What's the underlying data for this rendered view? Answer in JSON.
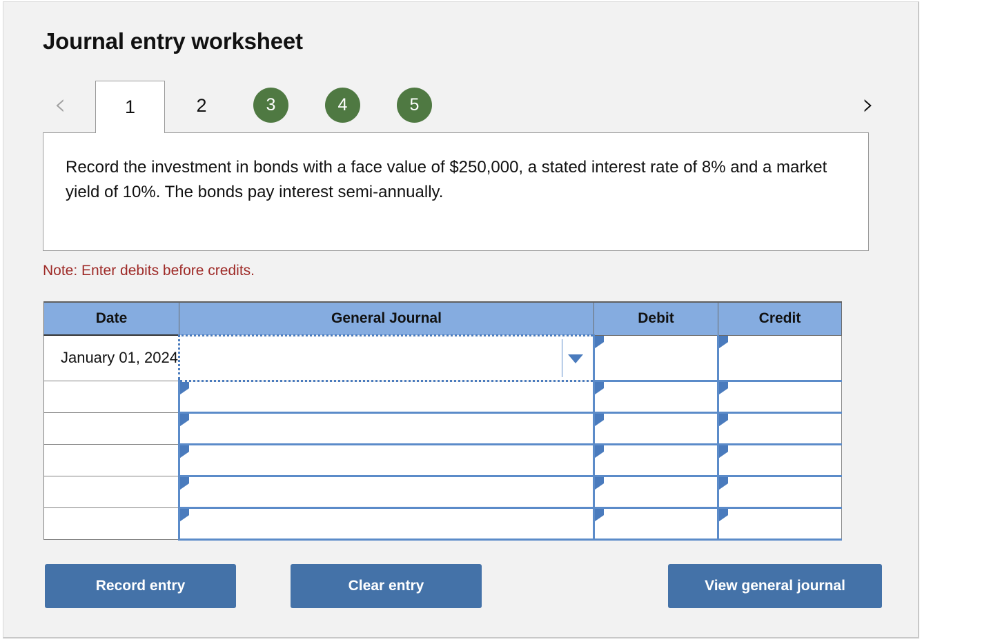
{
  "page": {
    "title": "Journal entry worksheet"
  },
  "nav": {
    "prev_icon": "chevron-left-icon",
    "next_icon": "chevron-right-icon",
    "prev_glyph": "‹",
    "next_glyph": "›",
    "tabs": [
      {
        "label": "1",
        "state": "active"
      },
      {
        "label": "2",
        "state": "plain"
      },
      {
        "label": "3",
        "state": "completed"
      },
      {
        "label": "4",
        "state": "completed"
      },
      {
        "label": "5",
        "state": "completed"
      }
    ],
    "completed_color": "#4f7942"
  },
  "description": {
    "text": "Record the investment in bonds with a face value of $250,000, a stated interest rate of 8% and a market yield of 10%. The bonds pay interest semi-annually."
  },
  "note": {
    "text": "Note: Enter debits before credits.",
    "color": "#9e2a27"
  },
  "journal": {
    "header_color": "#85ace0",
    "columns": [
      "Date",
      "General Journal",
      "Debit",
      "Credit"
    ],
    "rows": [
      {
        "date": "January 01, 2024",
        "general_journal": "",
        "debit": "",
        "credit": "",
        "selected": true,
        "dropdown_icon": "chevron-down-icon"
      },
      {
        "date": "",
        "general_journal": "",
        "debit": "",
        "credit": "",
        "selected": false
      },
      {
        "date": "",
        "general_journal": "",
        "debit": "",
        "credit": "",
        "selected": false
      },
      {
        "date": "",
        "general_journal": "",
        "debit": "",
        "credit": "",
        "selected": false
      },
      {
        "date": "",
        "general_journal": "",
        "debit": "",
        "credit": "",
        "selected": false
      },
      {
        "date": "",
        "general_journal": "",
        "debit": "",
        "credit": "",
        "selected": false
      }
    ]
  },
  "buttons": {
    "record": "Record entry",
    "clear": "Clear entry",
    "view": "View general journal",
    "color": "#4472a8"
  }
}
